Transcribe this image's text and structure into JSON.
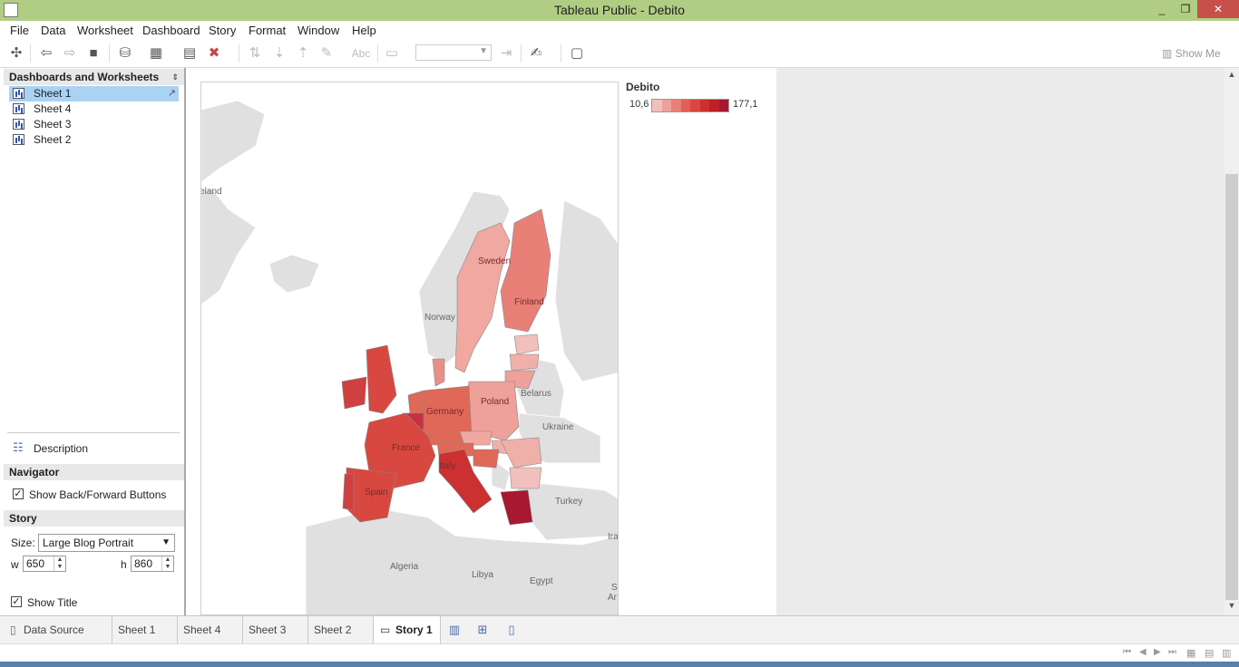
{
  "window": {
    "title": "Tableau Public - Debito",
    "minimize": "_",
    "restore": "❐",
    "close": "✕"
  },
  "menu": [
    "File",
    "Data",
    "Worksheet",
    "Dashboard",
    "Story",
    "Format",
    "Window",
    "Help"
  ],
  "toolbar": {
    "show_me": "Show Me",
    "abc": "Abc"
  },
  "left_panel": {
    "header": "Dashboards and Worksheets",
    "sheets": [
      {
        "label": "Sheet 1",
        "selected": true
      },
      {
        "label": "Sheet 4",
        "selected": false
      },
      {
        "label": "Sheet 3",
        "selected": false
      },
      {
        "label": "Sheet 2",
        "selected": false
      }
    ],
    "description": "Description",
    "navigator": {
      "header": "Navigator",
      "show_buttons": "Show Back/Forward Buttons",
      "checked": true
    },
    "story": {
      "header": "Story",
      "size_label": "Size:",
      "size_value": "Large Blog Portrait",
      "w_label": "w",
      "w_value": "650",
      "h_label": "h",
      "h_value": "860",
      "show_title": "Show Title",
      "show_title_checked": true
    }
  },
  "legend": {
    "title": "Debito",
    "min": "10,6",
    "max": "177,1",
    "colors": [
      "#f2c0bc",
      "#eea09a",
      "#e88078",
      "#e06058",
      "#d84840",
      "#cc3030",
      "#be2028",
      "#a81830"
    ]
  },
  "map": {
    "labels": [
      "Sweden",
      "Finland",
      "Norway",
      "Belarus",
      "Poland",
      "Germany",
      "Ukraine",
      "France",
      "Italy",
      "Spain",
      "Turkey",
      "Algeria",
      "Libya",
      "Egypt",
      "Ireland",
      "Ira",
      "S",
      "Ar"
    ],
    "colors": {
      "background_land": "#e0e0e0",
      "border": "#ffffff",
      "outline": "#9a9a9a"
    }
  },
  "tabs": {
    "data_source": "Data Source",
    "sheets": [
      "Sheet 1",
      "Sheet 4",
      "Sheet 3",
      "Sheet 2"
    ],
    "story": "Story 1"
  },
  "statusbar": {
    "nav": [
      "⏮",
      "◀",
      "▶",
      "⏭"
    ]
  }
}
